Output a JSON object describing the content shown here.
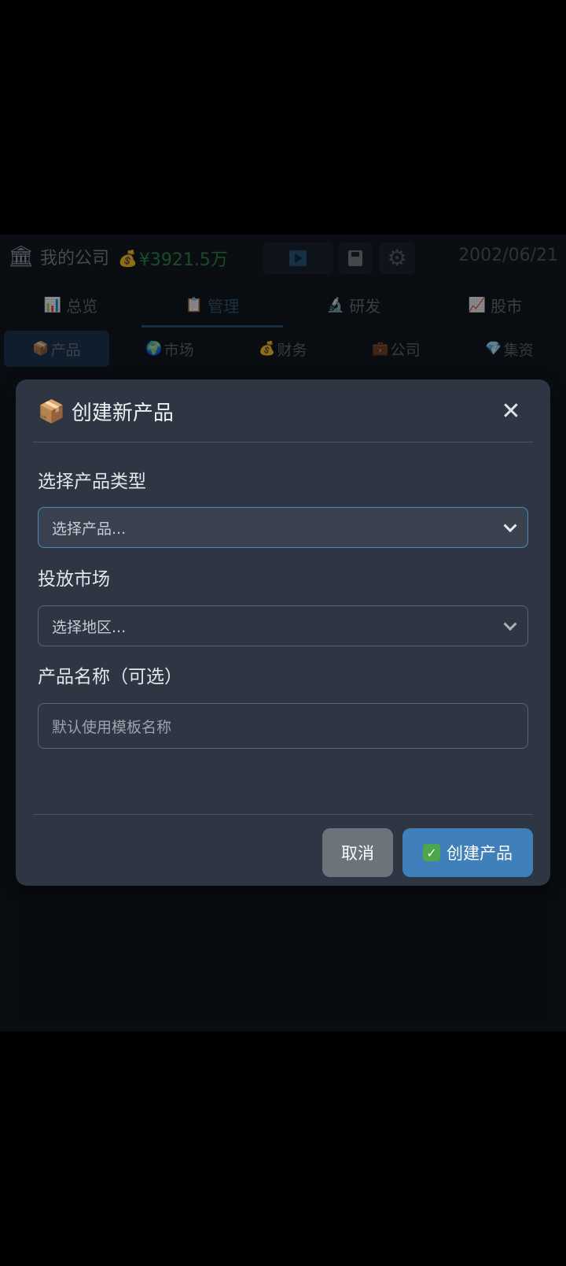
{
  "topbar": {
    "company_name": "我的公司",
    "money": "¥3921.5万",
    "date": "2002/06/21"
  },
  "tabs": [
    {
      "label": "总览",
      "icon": "📊"
    },
    {
      "label": "管理",
      "icon": "📋"
    },
    {
      "label": "研发",
      "icon": "🔬"
    },
    {
      "label": "股市",
      "icon": "📈"
    }
  ],
  "subtabs": [
    {
      "label": "产品",
      "icon": "📦"
    },
    {
      "label": "市场",
      "icon": "🌍"
    },
    {
      "label": "财务",
      "icon": "💰"
    },
    {
      "label": "公司",
      "icon": "💼"
    },
    {
      "label": "集资",
      "icon": "💎"
    }
  ],
  "modal": {
    "title": "创建新产品",
    "product_type_label": "选择产品类型",
    "product_type_value": "选择产品...",
    "market_label": "投放市场",
    "market_value": "选择地区...",
    "name_label": "产品名称（可选）",
    "name_placeholder": "默认使用模板名称",
    "cancel_label": "取消",
    "create_label": "创建产品"
  },
  "colors": {
    "accent": "#3f7fba",
    "money": "#2f8a48",
    "modal_bg": "#2e3643"
  }
}
